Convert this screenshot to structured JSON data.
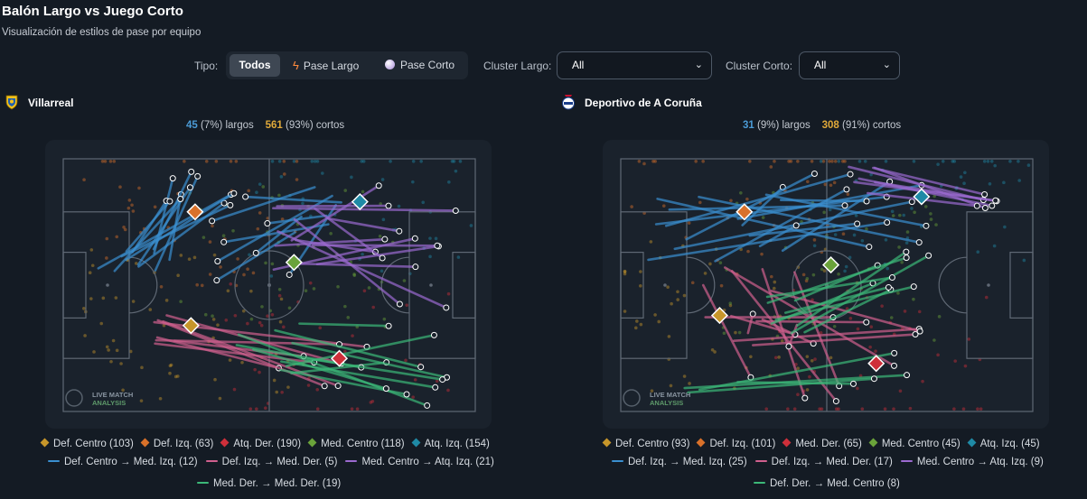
{
  "title": "Balón Largo vs Juego Corto",
  "subtitle": "Visualización de estilos de pase por equipo",
  "filters": {
    "tipo_label": "Tipo:",
    "tipo_options": [
      {
        "label": "Todos",
        "active": true
      },
      {
        "label": "Pase Largo",
        "icon": "lightning-icon",
        "active": false
      },
      {
        "label": "Pase Corto",
        "icon": "ball-icon",
        "active": false
      }
    ],
    "cluster_largo_label": "Cluster Largo:",
    "cluster_largo_value": "All",
    "cluster_corto_label": "Cluster Corto:",
    "cluster_corto_value": "All"
  },
  "colors": {
    "background": "#141b24",
    "long": "#4b9bd6",
    "short": "#e0a93a",
    "def_centro": "#c7962a",
    "def_izq": "#d9712a",
    "atq_der": "#cf2f3a",
    "med_centro": "#6aa33a",
    "atq_izq": "#1f8aa6",
    "flow_blue": "#3a8fd0",
    "flow_pink": "#d0608e",
    "flow_purple": "#9b6ad0",
    "flow_green": "#3cb878"
  },
  "watermark": {
    "line1": "LIVE MATCH",
    "line2": "ANALYSIS"
  },
  "teams": [
    {
      "name": "Villarreal",
      "crest_icon": "villarreal-crest-icon",
      "long_count": "45",
      "long_text": "(7%) largos",
      "short_count": "561",
      "short_text": "(93%) cortos",
      "clusters": [
        {
          "label": "Def. Centro (103)",
          "color": "#c7962a"
        },
        {
          "label": "Def. Izq. (63)",
          "color": "#d9712a"
        },
        {
          "label": "Atq. Der. (190)",
          "color": "#cf2f3a"
        },
        {
          "label": "Med. Centro (118)",
          "color": "#6aa33a"
        },
        {
          "label": "Atq. Izq. (154)",
          "color": "#1f8aa6"
        }
      ],
      "flows": [
        {
          "label": "Def. Centro → Med. Izq. (12)",
          "color": "#3a8fd0"
        },
        {
          "label": "Def. Izq. → Med. Der. (5)",
          "color": "#d0608e"
        },
        {
          "label": "Med. Centro → Atq. Izq. (21)",
          "color": "#9b6ad0"
        },
        {
          "label": "Med. Der. → Med. Der. (19)",
          "color": "#3cb878"
        }
      ]
    },
    {
      "name": "Deportivo de A Coruña",
      "crest_icon": "deportivo-crest-icon",
      "long_count": "31",
      "long_text": "(9%) largos",
      "short_count": "308",
      "short_text": "(91%) cortos",
      "clusters": [
        {
          "label": "Def. Centro (93)",
          "color": "#c7962a"
        },
        {
          "label": "Def. Izq. (101)",
          "color": "#d9712a"
        },
        {
          "label": "Med. Der. (65)",
          "color": "#cf2f3a"
        },
        {
          "label": "Med. Centro (45)",
          "color": "#6aa33a"
        },
        {
          "label": "Atq. Izq. (45)",
          "color": "#1f8aa6"
        }
      ],
      "flows": [
        {
          "label": "Def. Izq. → Med. Izq. (25)",
          "color": "#3a8fd0"
        },
        {
          "label": "Def. Izq. → Med. Der. (17)",
          "color": "#d0608e"
        },
        {
          "label": "Med. Centro → Atq. Izq. (9)",
          "color": "#9b6ad0"
        },
        {
          "label": "Def. Der. → Med. Centro (8)",
          "color": "#3cb878"
        }
      ]
    }
  ]
}
